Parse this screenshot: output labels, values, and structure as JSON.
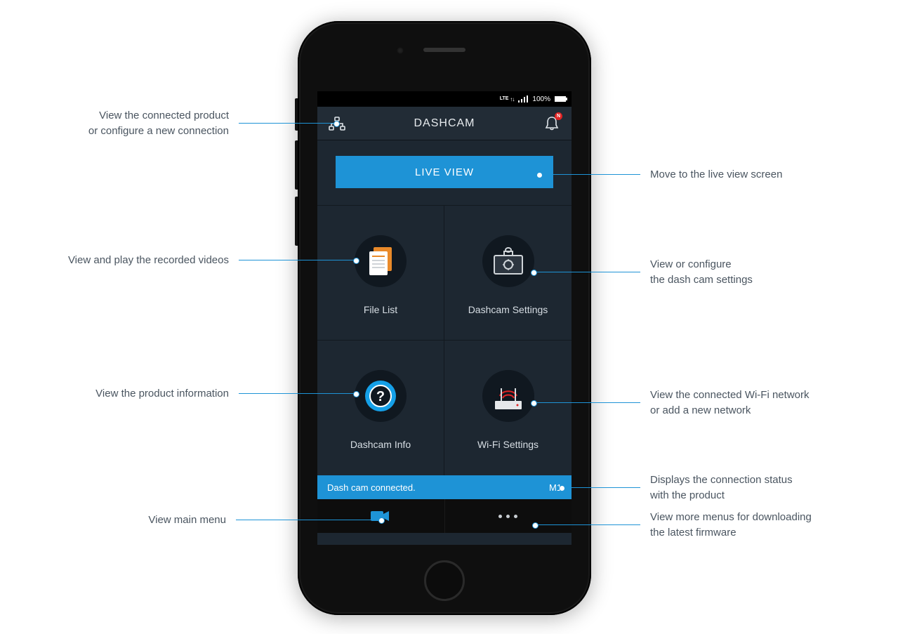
{
  "statusbar": {
    "network": "LTE",
    "battery": "100%"
  },
  "header": {
    "title": "DASHCAM",
    "badge": "N"
  },
  "live_button": "LIVE VIEW",
  "tiles": {
    "file_list": "File List",
    "settings": "Dashcam Settings",
    "info": "Dashcam Info",
    "wifi": "Wi-Fi Settings"
  },
  "connection": {
    "status": "Dash cam connected.",
    "model": "M1"
  },
  "callouts": {
    "conn_config": "View the connected product\nor configure a new connection",
    "recorded": "View and play the recorded videos",
    "product_info": "View the product information",
    "main_menu": "View main menu",
    "live_view": "Move to the live view screen",
    "dc_settings": "View or configure\nthe dash cam settings",
    "wifi": "View the connected Wi-Fi network\nor add a new network",
    "conn_status": "Displays the connection status\nwith the product",
    "more": "View more menus for downloading\nthe latest firmware"
  }
}
